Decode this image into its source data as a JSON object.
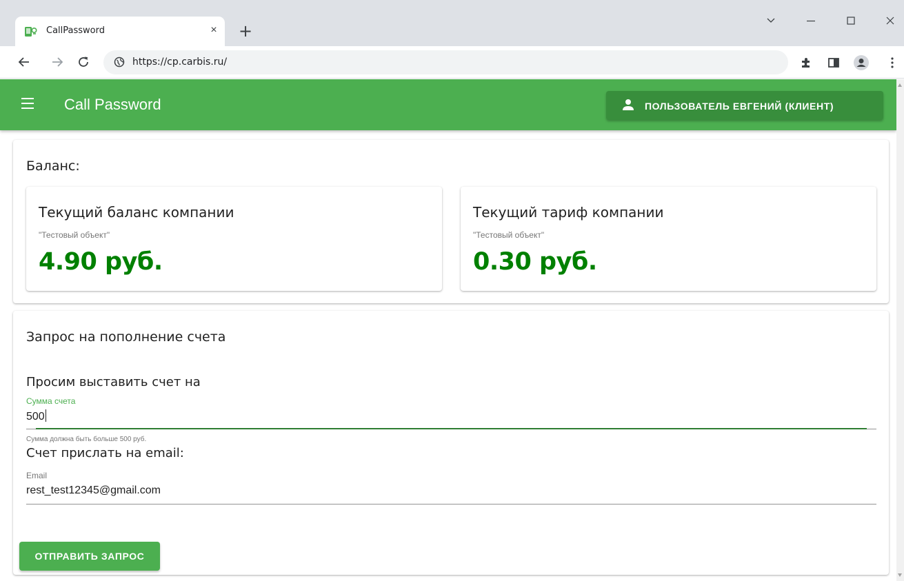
{
  "browser": {
    "tab_title": "CallPassword",
    "tab_close": "×",
    "new_tab": "+",
    "url": "https://cp.carbis.ru/",
    "window_controls": [
      "chevron-down-icon",
      "minimize-icon",
      "maximize-icon",
      "close-icon"
    ],
    "toolbar_icons": [
      "back-icon",
      "forward-icon",
      "reload-icon",
      "site-info-icon",
      "extensions-icon",
      "side-panel-icon",
      "profile-icon",
      "more-icon"
    ]
  },
  "app": {
    "title": "Call Password",
    "user_button_label": "ПОЛЬЗОВАТЕЛЬ ЕВГЕНИЙ (КЛИЕНТ)",
    "colors": {
      "primary": "#4caf50",
      "primary_dark": "#388e3c",
      "amount": "#008000",
      "active_field": "#4caf50"
    }
  },
  "balance": {
    "heading": "Баланс:",
    "cards": [
      {
        "title": "Текущий баланс компании",
        "subtitle": "\"Тестовый объект\"",
        "amount": "4.90 руб."
      },
      {
        "title": "Текущий тариф компании",
        "subtitle": "\"Тестовый объект\"",
        "amount": "0.30 руб."
      }
    ]
  },
  "request": {
    "heading": "Запрос на пополнение счета",
    "invoice_text": "Просим выставить счет на",
    "amount_field": {
      "label": "Сумма счета",
      "value": "500",
      "hint": "Сумма должна быть больше 500 руб."
    },
    "email_text": "Счет прислать на email:",
    "email_field": {
      "label": "Email",
      "value": "rest_test12345@gmail.com"
    },
    "submit_label": "ОТПРАВИТЬ ЗАПРОС"
  }
}
